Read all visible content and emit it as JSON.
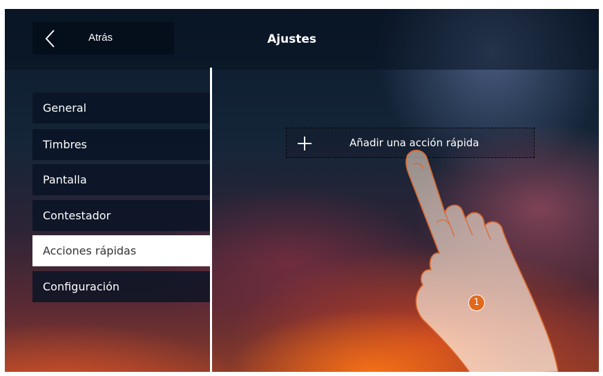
{
  "header": {
    "back_label": "Atrás",
    "title": "Ajustes"
  },
  "menu": {
    "items": [
      {
        "label": "General"
      },
      {
        "label": "Timbres"
      },
      {
        "label": "Pantalla"
      },
      {
        "label": "Contestador"
      },
      {
        "label": "Acciones rápidas"
      },
      {
        "label": "Configuración"
      }
    ],
    "active_index": 4
  },
  "main": {
    "add_action_label": "Añadir una acción rápida",
    "add_icon": "plus-icon"
  },
  "overlay": {
    "step_number": "1",
    "pointer_icon": "hand-pointer-icon"
  },
  "colors": {
    "accent": "#e2681c",
    "active_item_bg": "#ffffff",
    "panel_bg": "#0b1526"
  }
}
